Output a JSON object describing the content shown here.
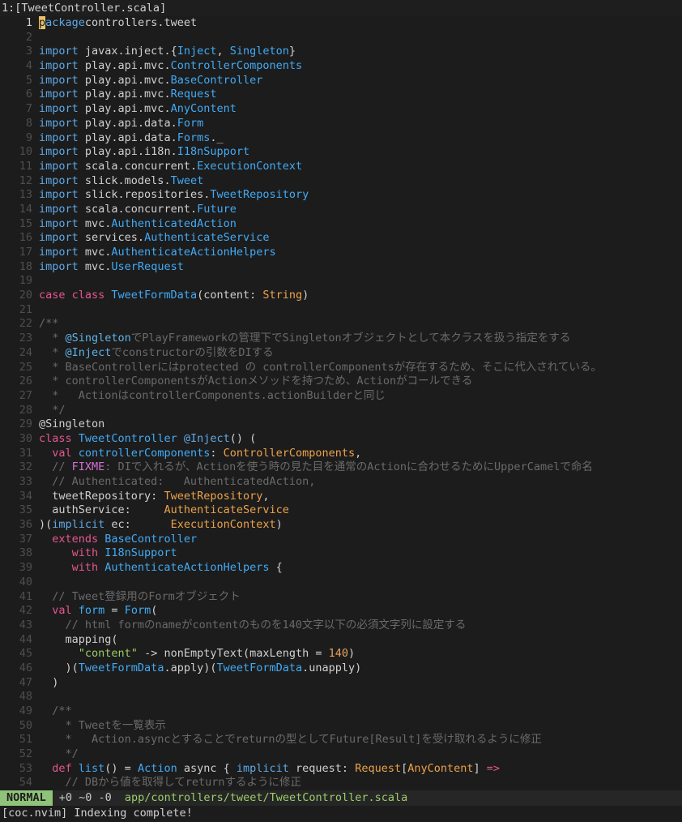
{
  "tab_title": "1:[TweetController.scala]",
  "code_lines": [
    [
      [
        "kw",
        "package"
      ],
      [
        "",
        "controllers.tweet"
      ]
    ],
    [],
    [
      [
        "kw",
        "import "
      ],
      [
        "",
        "javax.inject.{"
      ],
      [
        "ty",
        "Inject"
      ],
      [
        "",
        ", "
      ],
      [
        "ty",
        "Singleton"
      ],
      [
        "",
        "}"
      ]
    ],
    [
      [
        "kw",
        "import "
      ],
      [
        "",
        "play.api.mvc."
      ],
      [
        "ty",
        "ControllerComponents"
      ]
    ],
    [
      [
        "kw",
        "import "
      ],
      [
        "",
        "play.api.mvc."
      ],
      [
        "ty",
        "BaseController"
      ]
    ],
    [
      [
        "kw",
        "import "
      ],
      [
        "",
        "play.api.mvc."
      ],
      [
        "ty",
        "Request"
      ]
    ],
    [
      [
        "kw",
        "import "
      ],
      [
        "",
        "play.api.mvc."
      ],
      [
        "ty",
        "AnyContent"
      ]
    ],
    [
      [
        "kw",
        "import "
      ],
      [
        "",
        "play.api.data."
      ],
      [
        "ty",
        "Form"
      ]
    ],
    [
      [
        "kw",
        "import "
      ],
      [
        "",
        "play.api.data."
      ],
      [
        "ty",
        "Forms"
      ],
      [
        "",
        "._"
      ]
    ],
    [
      [
        "kw",
        "import "
      ],
      [
        "",
        "play.api.i18n."
      ],
      [
        "ty",
        "I18nSupport"
      ]
    ],
    [
      [
        "kw",
        "import "
      ],
      [
        "",
        "scala.concurrent."
      ],
      [
        "ty",
        "ExecutionContext"
      ]
    ],
    [
      [
        "kw",
        "import "
      ],
      [
        "",
        "slick.models."
      ],
      [
        "ty",
        "Tweet"
      ]
    ],
    [
      [
        "kw",
        "import "
      ],
      [
        "",
        "slick.repositories."
      ],
      [
        "ty",
        "TweetRepository"
      ]
    ],
    [
      [
        "kw",
        "import "
      ],
      [
        "",
        "scala.concurrent."
      ],
      [
        "ty",
        "Future"
      ]
    ],
    [
      [
        "kw",
        "import "
      ],
      [
        "",
        "mvc."
      ],
      [
        "ty",
        "AuthenticatedAction"
      ]
    ],
    [
      [
        "kw",
        "import "
      ],
      [
        "",
        "services."
      ],
      [
        "ty",
        "AuthenticateService"
      ]
    ],
    [
      [
        "kw",
        "import "
      ],
      [
        "",
        "mvc."
      ],
      [
        "ty",
        "AuthenticateActionHelpers"
      ]
    ],
    [
      [
        "kw",
        "import "
      ],
      [
        "",
        "mvc."
      ],
      [
        "ty",
        "UserRequest"
      ]
    ],
    [],
    [
      [
        "kr",
        "case class "
      ],
      [
        "ty",
        "TweetFormData"
      ],
      [
        "",
        "(content: "
      ],
      [
        "tg",
        "String"
      ],
      [
        "",
        ")"
      ]
    ],
    [],
    [
      [
        "cm",
        "/**"
      ]
    ],
    [
      [
        "cm",
        "  * "
      ],
      [
        "an",
        "@Singleton"
      ],
      [
        "cm",
        "でPlayFrameworkの管理下でSingletonオブジェクトとして本クラスを扱う指定をする"
      ]
    ],
    [
      [
        "cm",
        "  * "
      ],
      [
        "an",
        "@Inject"
      ],
      [
        "cm",
        "でconstructorの引数をDIする"
      ]
    ],
    [
      [
        "cm",
        "  * BaseControllerにはprotected の controllerComponentsが存在するため、そこに代入されている。"
      ]
    ],
    [
      [
        "cm",
        "  * controllerComponentsがActionメソッドを持つため、Actionがコールできる"
      ]
    ],
    [
      [
        "cm",
        "  *   ActionはcontrollerComponents.actionBuilderと同じ"
      ]
    ],
    [
      [
        "cm",
        "  */"
      ]
    ],
    [
      [
        "",
        "@Singleton"
      ]
    ],
    [
      [
        "kr",
        "class "
      ],
      [
        "ty",
        "TweetController "
      ],
      [
        "kw",
        "@Inject"
      ],
      [
        "",
        "() ("
      ]
    ],
    [
      [
        "",
        "  "
      ],
      [
        "kr",
        "val "
      ],
      [
        "ty",
        "controllerComponents"
      ],
      [
        "",
        ": "
      ],
      [
        "tg",
        "ControllerComponents"
      ],
      [
        "",
        ","
      ]
    ],
    [
      [
        "cm",
        "  // "
      ],
      [
        "fx",
        "FIXME"
      ],
      [
        "cm",
        ": DIで入れるが、Actionを使う時の見た目を通常のActionに合わせるためにUpperCamelで命名"
      ]
    ],
    [
      [
        "cm",
        "  // Authenticated:   AuthenticatedAction,"
      ]
    ],
    [
      [
        "",
        "  tweetRepository: "
      ],
      [
        "tg",
        "TweetRepository"
      ],
      [
        "",
        ","
      ]
    ],
    [
      [
        "",
        "  authService:     "
      ],
      [
        "tg",
        "AuthenticateService"
      ]
    ],
    [
      [
        "",
        ")("
      ],
      [
        "kw",
        "implicit "
      ],
      [
        "",
        "ec:      "
      ],
      [
        "tg",
        "ExecutionContext"
      ],
      [
        "",
        ")"
      ]
    ],
    [
      [
        "",
        "  "
      ],
      [
        "kr",
        "extends "
      ],
      [
        "ty",
        "BaseController"
      ]
    ],
    [
      [
        "",
        "     "
      ],
      [
        "kr",
        "with "
      ],
      [
        "ty",
        "I18nSupport"
      ]
    ],
    [
      [
        "",
        "     "
      ],
      [
        "kr",
        "with "
      ],
      [
        "ty",
        "AuthenticateActionHelpers"
      ],
      [
        "",
        " {"
      ]
    ],
    [],
    [
      [
        "cm",
        "  // Tweet登録用のFormオブジェクト"
      ]
    ],
    [
      [
        "",
        "  "
      ],
      [
        "kr",
        "val "
      ],
      [
        "ty",
        "form"
      ],
      [
        "",
        " = "
      ],
      [
        "ty",
        "Form"
      ],
      [
        "",
        "("
      ]
    ],
    [
      [
        "cm",
        "    // html formのnameがcontentのものを140文字以下の必須文字列に設定する"
      ]
    ],
    [
      [
        "",
        "    mapping("
      ]
    ],
    [
      [
        "",
        "      "
      ],
      [
        "st",
        "\"content\""
      ],
      [
        "",
        " -> nonEmptyText(maxLength = "
      ],
      [
        "nm",
        "140"
      ],
      [
        "",
        ")"
      ]
    ],
    [
      [
        "",
        "    )("
      ],
      [
        "ty",
        "TweetFormData"
      ],
      [
        "",
        ".apply)("
      ],
      [
        "ty",
        "TweetFormData"
      ],
      [
        "",
        ".unapply)"
      ]
    ],
    [
      [
        "",
        "  )"
      ]
    ],
    [],
    [
      [
        "cm",
        "  /**"
      ]
    ],
    [
      [
        "cm",
        "    * Tweetを一覧表示"
      ]
    ],
    [
      [
        "cm",
        "    *   Action.asyncとすることでreturnの型としてFuture[Result]を受け取れるように修正"
      ]
    ],
    [
      [
        "cm",
        "    */"
      ]
    ],
    [
      [
        "",
        "  "
      ],
      [
        "kr",
        "def "
      ],
      [
        "ty",
        "list"
      ],
      [
        "",
        "() = "
      ],
      [
        "ty",
        "Action"
      ],
      [
        "",
        " async { "
      ],
      [
        "kw",
        "implicit "
      ],
      [
        "",
        "request: "
      ],
      [
        "tg",
        "Request"
      ],
      [
        "",
        "["
      ],
      [
        "tg",
        "AnyContent"
      ],
      [
        "",
        "] "
      ],
      [
        "kr",
        "=>"
      ]
    ],
    [
      [
        "cm",
        "    // DBから値を取得してreturnするように修正"
      ]
    ]
  ],
  "status": {
    "mode": "NORMAL",
    "git": "+0 ~0 -0",
    "path": "app/controllers/tweet/TweetController.scala"
  },
  "cmdline": "[coc.nvim] Indexing complete!"
}
